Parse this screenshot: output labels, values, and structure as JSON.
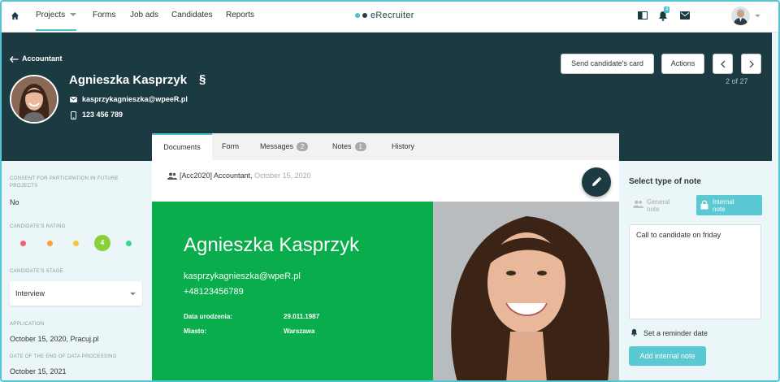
{
  "nav": {
    "home_icon": "home-icon",
    "items": [
      {
        "label": "Projects"
      },
      {
        "label": "Forms"
      },
      {
        "label": "Job ads"
      },
      {
        "label": "Candidates"
      },
      {
        "label": "Reports"
      }
    ],
    "logo": "eRecruiter",
    "notification_count": "4"
  },
  "header": {
    "back_label": "Accountant",
    "name": "Agnieszka Kasprzyk",
    "section_sign": "§",
    "email": "kasprzykagnieszka@wpeeR.pl",
    "phone": "123 456 789",
    "send_card": "Send candidate's card",
    "actions": "Actions",
    "pager": "2 of 27"
  },
  "tabs": [
    {
      "label": "Documents"
    },
    {
      "label": "Form"
    },
    {
      "label": "Messages",
      "badge": "2"
    },
    {
      "label": "Notes",
      "badge": "1"
    },
    {
      "label": "History"
    }
  ],
  "sidebar": {
    "consent_label": "CONSENT FOR PARTICIPATION IN FUTURE PROJECTS",
    "consent_value": "No",
    "rating_label": "CANDIDATE'S RATING",
    "rating_value": "4",
    "stage_label": "CANDIDATE'S STAGE",
    "stage_value": "Interview",
    "application_label": "APPLICATION",
    "application_value": "October 15, 2020, Pracuj.pl",
    "end_label": "DATE OF THE END OF DATA PROCESSING",
    "end_value": "October 15, 2021"
  },
  "document": {
    "project": "[Acc2020] Accountant,",
    "date": "October 15, 2020",
    "cv_name": "Agnieszka Kasprzyk",
    "cv_email": "kasprzykagnieszka@wpeR.pl",
    "cv_phone": "+48123456789",
    "birth_label": "Data urodzenia:",
    "birth_value": "29.011.1987",
    "city_label": "Miasto:",
    "city_value": "Warszawa"
  },
  "notes": {
    "title": "Select type of note",
    "general_l1": "General",
    "general_l2": "note",
    "internal_l1": "Internal",
    "internal_l2": "note",
    "text": "Call to candidate on friday",
    "reminder": "Set a reminder date",
    "add_button": "Add internal note"
  },
  "colors": {
    "accent": "#4cc2ce",
    "header_bg": "#1c3a42",
    "cv_green": "#0aad4c"
  }
}
